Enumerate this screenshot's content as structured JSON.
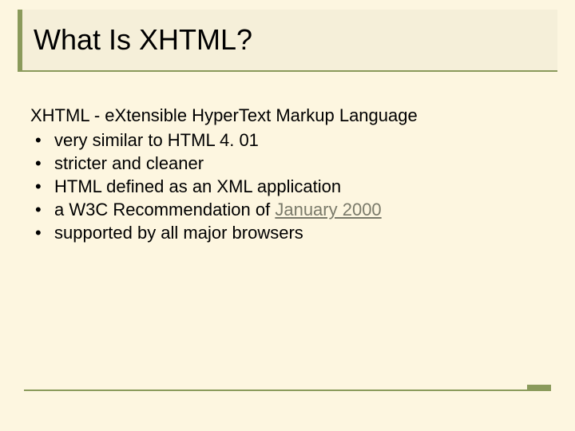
{
  "header": {
    "title": "What Is XHTML?"
  },
  "body": {
    "intro_prefix": "XHTML - e",
    "intro_x": "X",
    "intro_mid1": "tensible ",
    "intro_h": "H",
    "intro_mid2": "yper",
    "intro_t": "T",
    "intro_mid3": "ext ",
    "intro_m": "M",
    "intro_mid4": "arkup ",
    "intro_l": "L",
    "intro_end": "anguage",
    "bullets": [
      "very similar to HTML 4. 01",
      "stricter and cleaner",
      "HTML defined as an XML application"
    ],
    "bullet4_prefix": "a W3C Recommendation of ",
    "bullet4_link": "January 2000",
    "bullet5": "supported by all major browsers"
  }
}
